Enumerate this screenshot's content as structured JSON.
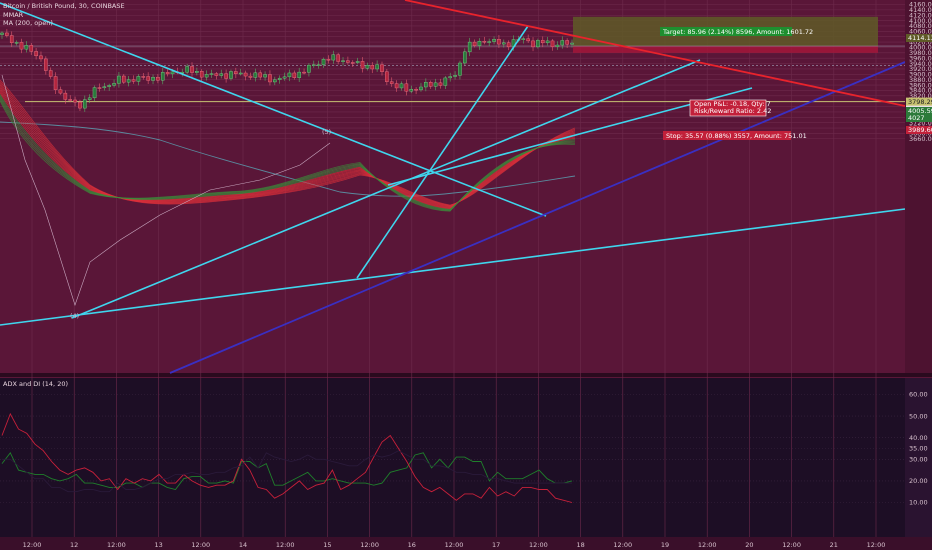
{
  "header": {
    "symbol_title": "Bitcoin / British Pound, 30, COINBASE",
    "indicators": [
      "MMAR",
      "MA (200, open)"
    ]
  },
  "adx_panel": {
    "title": "ADX and DI (14, 20)"
  },
  "position_tool": {
    "target_label": "Target: 85.96 (2.14%) 8596, Amount: 1601.72",
    "stop_label": "Stop: 35.57 (0.88%) 3557, Amount: 751.01",
    "pnl_label_line1": "Open P&L: -0.18, Qty: 7",
    "pnl_label_line2": "Risk/Reward Ratio: 2.42"
  },
  "price_tags": {
    "target": "4114.13",
    "current": "4005.17",
    "entry_a": "4005.59",
    "entry_b": "4027",
    "stop": "3989.60",
    "support": "3798.29"
  },
  "wave_labels": [
    "(5)",
    "(4)"
  ],
  "colors": {
    "background": "#5a1638",
    "trendline": "#3fd6ee",
    "resistance": "#e8232c",
    "channel": "#3a2fc2",
    "target_zone": "#5f5a27",
    "stop_zone": "#a3163a",
    "adx_background": "#1d0e25",
    "di_plus": "#1f7f2b",
    "di_minus": "#c8203a"
  },
  "chart_data": [
    {
      "type": "candlestick",
      "title": "Bitcoin / British Pound, 30, COINBASE",
      "y_axis_ticks": [
        4160,
        4140,
        4120,
        4100,
        4080,
        4060,
        4040,
        4020,
        4000,
        3980,
        3960,
        3940,
        3920,
        3900,
        3880,
        3860,
        3840,
        3820,
        3800,
        3780,
        3760,
        3740,
        3720,
        3700,
        3680,
        3660
      ],
      "ylim": [
        3650,
        4165
      ],
      "x_axis_ticks": [
        "12:00",
        "12",
        "12:00",
        "13",
        "12:00",
        "14",
        "12:00",
        "15",
        "12:00",
        "16",
        "12:00",
        "17",
        "12:00",
        "18",
        "12:00",
        "19",
        "12:00",
        "20",
        "12:00",
        "21",
        "12:00"
      ],
      "series": [
        {
          "name": "MMAR"
        },
        {
          "name": "MA (200, open)"
        }
      ],
      "close_path": [
        4048,
        4030,
        4000,
        3990,
        3960,
        3880,
        3830,
        3800,
        3780,
        3820,
        3850,
        3860,
        3880,
        3875,
        3890,
        3880,
        3890,
        3900,
        3910,
        3920,
        3905,
        3900,
        3895,
        3898,
        3905,
        3895,
        3900,
        3890,
        3880,
        3885,
        3900,
        3905,
        3930,
        3950,
        3960,
        3955,
        3945,
        3935,
        3930,
        3925,
        3870,
        3855,
        3840,
        3850,
        3860,
        3865,
        3880,
        3900,
        4005,
        4010,
        4030,
        4020,
        4010,
        4025,
        4030,
        4015,
        4020,
        4010,
        4020,
        4006
      ],
      "levels": {
        "target": 4114.13,
        "entry": 4005.17,
        "stop": 3989.6,
        "support": 3798.29
      }
    },
    {
      "type": "line",
      "title": "ADX and DI (14, 20)",
      "y_axis_ticks": [
        60,
        50,
        40,
        35,
        30,
        20,
        10
      ],
      "ylim": [
        5,
        65
      ],
      "series": [
        {
          "values": [
            28,
            33,
            25,
            24,
            23,
            23,
            21,
            20,
            21,
            23,
            19,
            19,
            18,
            17,
            17,
            19,
            19,
            17,
            19,
            19,
            17,
            16,
            21,
            22,
            22,
            19,
            19,
            20,
            19,
            29,
            29,
            26,
            28,
            18,
            18,
            20,
            22,
            24,
            20,
            20,
            21,
            20,
            19,
            19,
            19,
            18,
            19,
            24,
            25,
            26,
            32,
            33,
            26,
            30,
            26,
            31,
            31,
            29,
            29,
            20,
            24,
            21,
            21,
            21,
            23,
            25,
            21,
            19,
            19,
            20
          ]
        },
        {
          "values": [
            41,
            51,
            44,
            42,
            37,
            34,
            29,
            25,
            23,
            25,
            26,
            24,
            20,
            21,
            16,
            21,
            19,
            21,
            20,
            23,
            19,
            19,
            23,
            20,
            18,
            17,
            18,
            18,
            20,
            30,
            25,
            17,
            16,
            12,
            14,
            17,
            20,
            16,
            18,
            19,
            25,
            16,
            18,
            21,
            24,
            31,
            38,
            41,
            35,
            29,
            22,
            17,
            15,
            17,
            14,
            11,
            14,
            14,
            12,
            17,
            13,
            15,
            13,
            17,
            17,
            16,
            16,
            12,
            11,
            10
          ]
        },
        {
          "values": [
            30,
            30,
            27,
            24,
            21,
            21,
            17,
            17,
            15,
            15,
            16,
            16,
            15,
            15,
            19,
            16,
            16,
            17,
            19,
            21,
            21,
            23,
            23,
            24,
            23,
            23,
            24,
            24,
            26,
            27,
            31,
            26,
            33,
            31,
            30,
            29,
            30,
            32,
            30,
            30,
            29,
            28,
            27,
            27,
            30,
            32,
            31,
            32,
            34,
            32,
            30,
            30,
            27,
            27,
            26,
            24,
            24,
            23,
            23,
            21,
            21,
            20,
            19,
            19,
            19,
            19,
            19,
            19,
            19,
            19
          ]
        }
      ]
    }
  ]
}
